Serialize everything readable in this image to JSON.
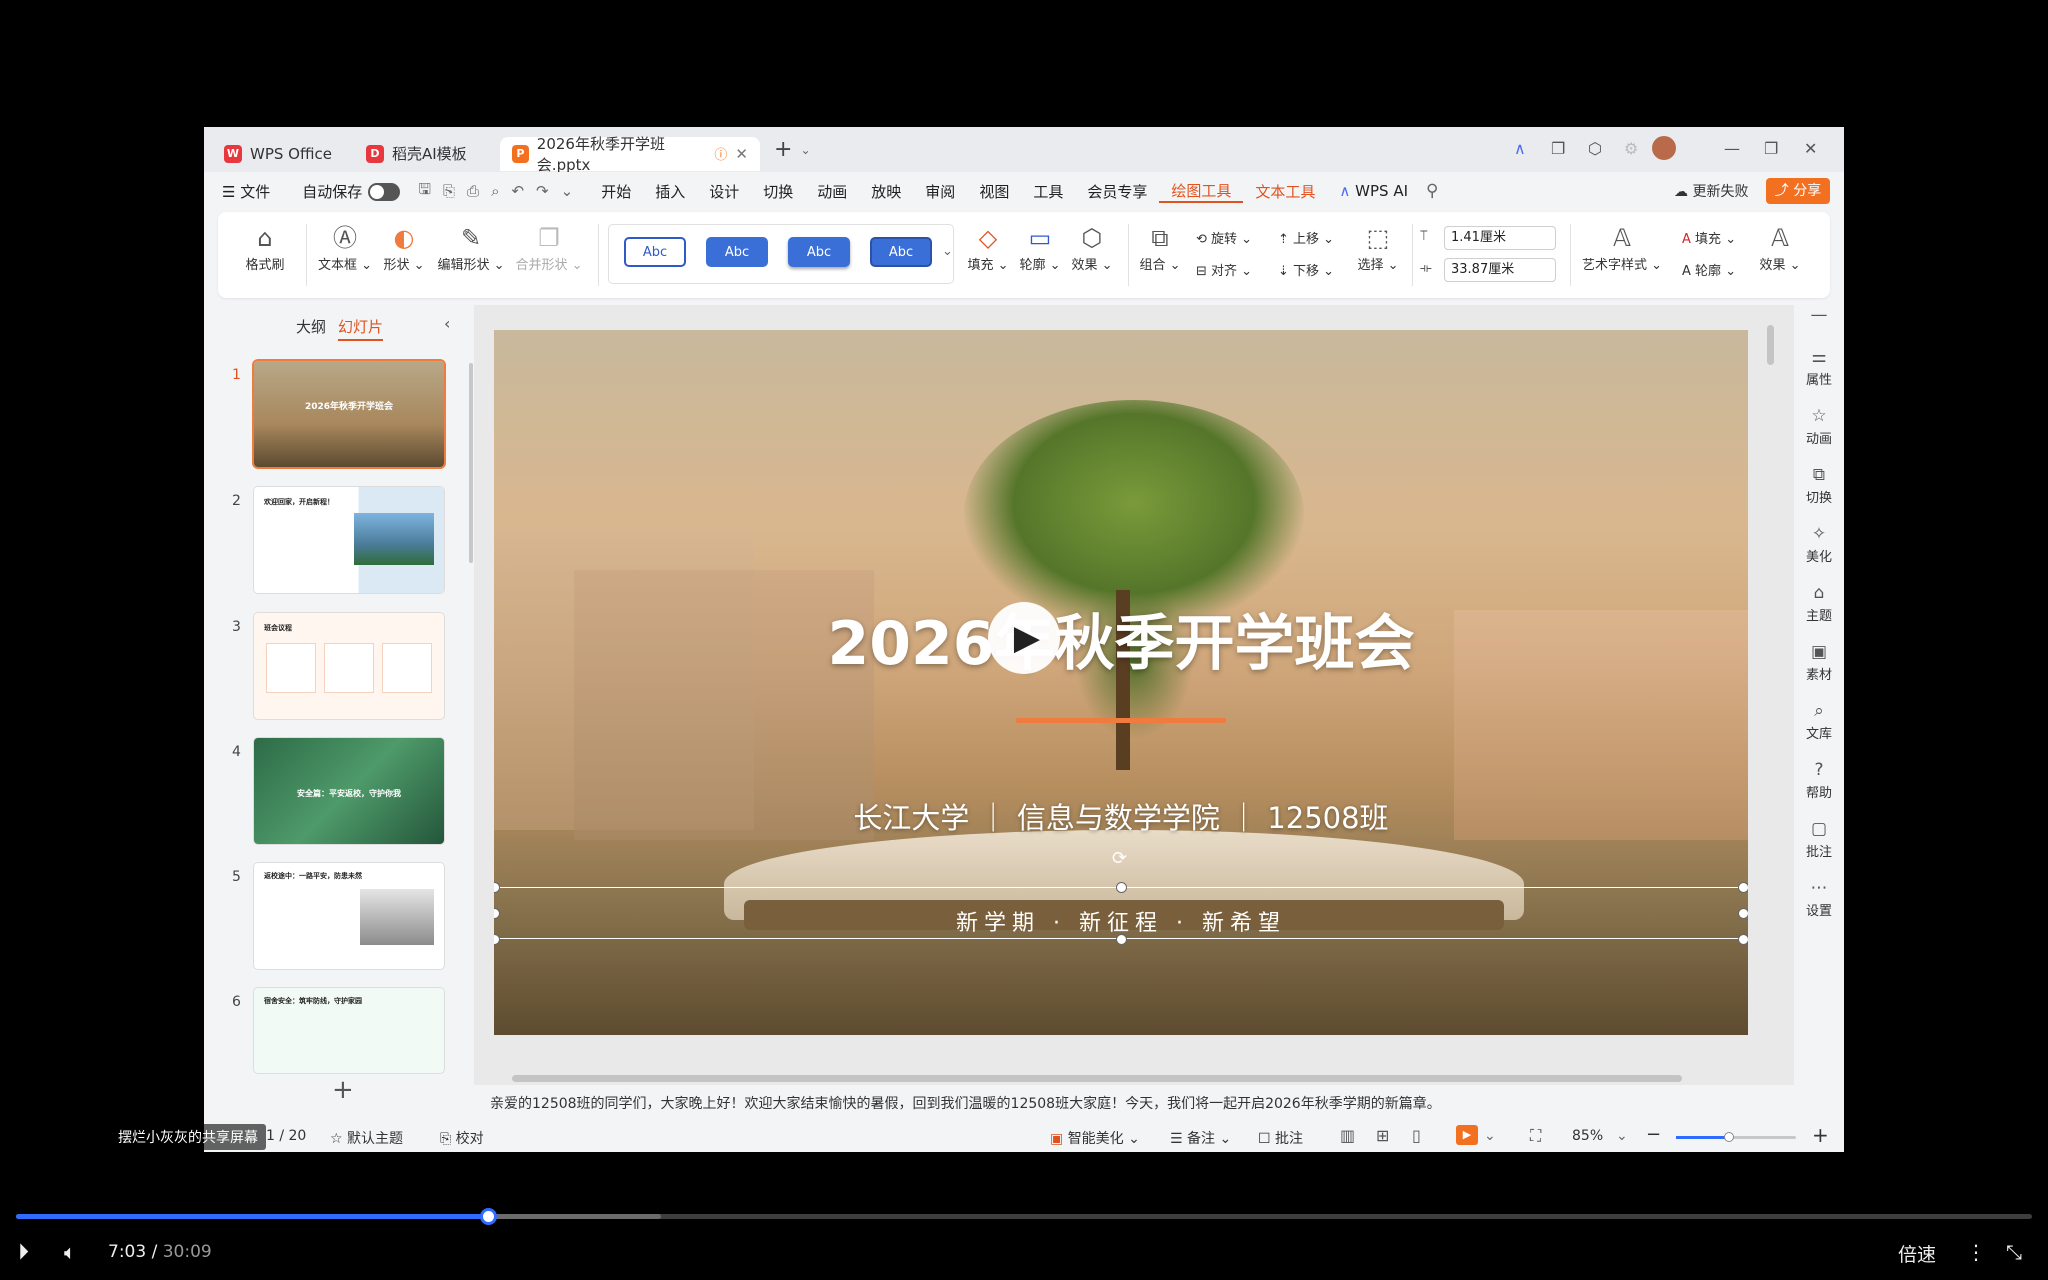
{
  "colors": {
    "accent": "#e0531f",
    "share": "#f37021",
    "progress": "#2f6bff"
  },
  "titlebar": {
    "tabs": [
      {
        "label": "WPS Office",
        "icon": "wps-logo-icon"
      },
      {
        "label": "稻壳AI模板",
        "icon": "docer-icon"
      },
      {
        "label": "2026年秋季开学班会.pptx",
        "icon": "ppt-file-icon"
      }
    ]
  },
  "menubar": {
    "file": "文件",
    "autosave": "自动保存",
    "items": [
      "开始",
      "插入",
      "设计",
      "切换",
      "动画",
      "放映",
      "审阅",
      "视图",
      "工具",
      "会员专享",
      "绘图工具",
      "文本工具",
      "WPS AI"
    ],
    "update_failed": "更新失败",
    "share": "分享"
  },
  "ribbon": {
    "format_painter": "格式刷",
    "textbox": "文本框",
    "shape": "形状",
    "edit_shape": "编辑形状",
    "merge_shape": "合并形状",
    "style_samples": [
      "Abc",
      "Abc",
      "Abc",
      "Abc"
    ],
    "fill": "填充",
    "outline": "轮廓",
    "effect": "效果",
    "group": "组合",
    "rotate": "旋转",
    "align": "对齐",
    "bring_up": "上移",
    "send_down": "下移",
    "select": "选择",
    "height": "1.41厘米",
    "width": "33.87厘米",
    "art_style": "艺术字样式",
    "text_fill": "填充",
    "text_outline": "轮廓",
    "text_effect": "效果"
  },
  "leftpanel": {
    "tab_outline": "大纲",
    "tab_slides": "幻灯片",
    "slides": [
      {
        "num": "1",
        "title": "2026年秋季开学班会"
      },
      {
        "num": "2",
        "title": "欢迎回家，开启新程！"
      },
      {
        "num": "3",
        "title": "班会议程"
      },
      {
        "num": "4",
        "title": "安全篇：平安返校，守护你我"
      },
      {
        "num": "5",
        "title": "返校途中：一路平安，防患未然"
      },
      {
        "num": "6",
        "title": "宿舍安全：筑牢防线，守护家园"
      }
    ]
  },
  "slide": {
    "title": "2026年秋季开学班会",
    "subtitle": "长江大学 ｜ 信息与数学学院 ｜ 12508班",
    "tagline": "新学期 · 新征程 · 新希望"
  },
  "rail": [
    "属性",
    "动画",
    "切换",
    "美化",
    "主题",
    "素材",
    "文库",
    "帮助",
    "批注",
    "设置"
  ],
  "notes": "亲爱的12508班的同学们，大家晚上好！欢迎大家结束愉快的暑假，回到我们温暖的12508班大家庭！今天，我们将一起开启2026年秋季学期的新篇章。",
  "status": {
    "page": "1 / 20",
    "theme": "默认主题",
    "proof": "校对",
    "smart_beautify": "智能美化",
    "remarks": "备注",
    "comments": "批注",
    "zoom": "85%"
  },
  "video": {
    "caption": "摆烂小灰灰的共享屏幕",
    "current": "7:03",
    "separator": " / ",
    "total": "30:09",
    "played_fraction": 0.234,
    "buffered_fraction": 0.32,
    "speed": "倍速"
  }
}
